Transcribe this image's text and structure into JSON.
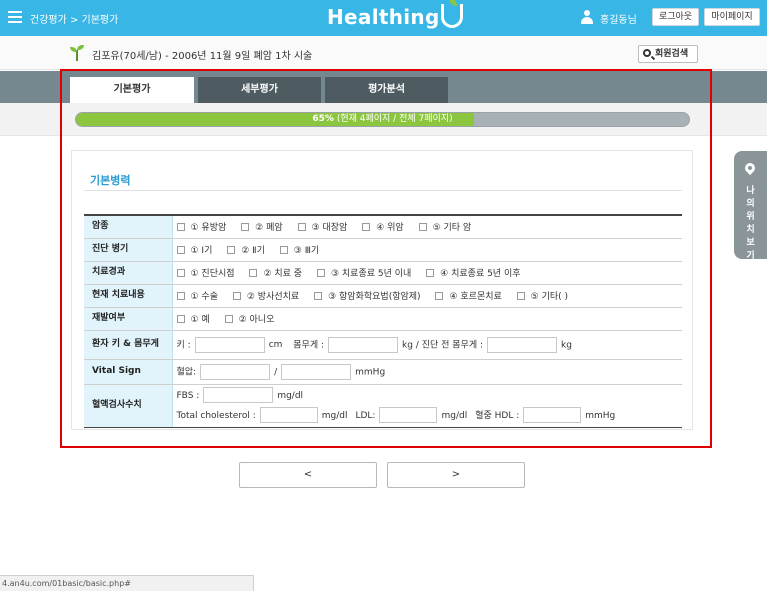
{
  "header": {
    "breadcrumb": "건강평가 > 기본평가",
    "logo": "Healthing",
    "user_name": "홍길동님",
    "logout_label": "로그아웃",
    "mypage_label": "마이페이지"
  },
  "patient": {
    "info": "김포유(70세/남) - 2006년 11월 9일 폐암 1차 시술",
    "member_search_label": "회원검색"
  },
  "tabs": [
    {
      "label": "기본평가"
    },
    {
      "label": "세부평가"
    },
    {
      "label": "평가분석"
    }
  ],
  "progress": {
    "percent": 65,
    "percent_label": "65%",
    "detail": "(현재 4페이지 / 전체 7페이지)"
  },
  "section": {
    "title": "기본병력"
  },
  "form": {
    "cancer_type": {
      "label": "암종",
      "options": [
        "① 유방암",
        "② 폐암",
        "③ 대장암",
        "④ 위암",
        "⑤ 기타 암"
      ]
    },
    "diagnosis_stage": {
      "label": "진단 병기",
      "options": [
        "① Ⅰ기",
        "② Ⅱ기",
        "③ Ⅲ기"
      ]
    },
    "treatment_progress": {
      "label": "치료경과",
      "options": [
        "① 진단시점",
        "② 치료 중",
        "③ 치료종료 5년 이내",
        "④ 치료종료 5년 이후"
      ]
    },
    "current_treatment": {
      "label": "현재 치료내용",
      "options": [
        "① 수술",
        "② 방사선치료",
        "③ 항암화학요법(항암제)",
        "④ 호르몬치료",
        "⑤ 기타( )"
      ]
    },
    "recurrence": {
      "label": "재발여부",
      "options": [
        "① 예",
        "② 아니오"
      ]
    },
    "body": {
      "label": "환자 키 & 몸무게",
      "height_label": "키 :",
      "height_unit": "cm",
      "weight_label": "몸무게 :",
      "weight_unit": "kg / 진단 전 몸무게 :",
      "pre_weight_unit": "kg"
    },
    "vital": {
      "label": "Vital Sign",
      "bp_label": "혈압:",
      "separator": "/",
      "unit": "mmHg"
    },
    "blood": {
      "label": "혈액검사수치",
      "fbs_label": "FBS :",
      "fbs_unit": "mg/dl",
      "chol_label": "Total cholesterol :",
      "chol_unit": "mg/dl",
      "ldl_label": "LDL:",
      "ldl_unit": "mg/dl",
      "hdl_label": "혈중 HDL :",
      "hdl_unit": "mmHg"
    }
  },
  "nav": {
    "prev_label": "<",
    "next_label": ">"
  },
  "side": {
    "location_label": "나의위치보기"
  },
  "status_url": "4.an4u.com/01basic/basic.php#",
  "colors": {
    "header_bg": "#38b6e6",
    "tab_band": "#76888f",
    "progress_fill": "#8cc63f",
    "section_title": "#2a9dd4",
    "label_bg": "#e1f3fb",
    "highlight": "#e00000"
  }
}
